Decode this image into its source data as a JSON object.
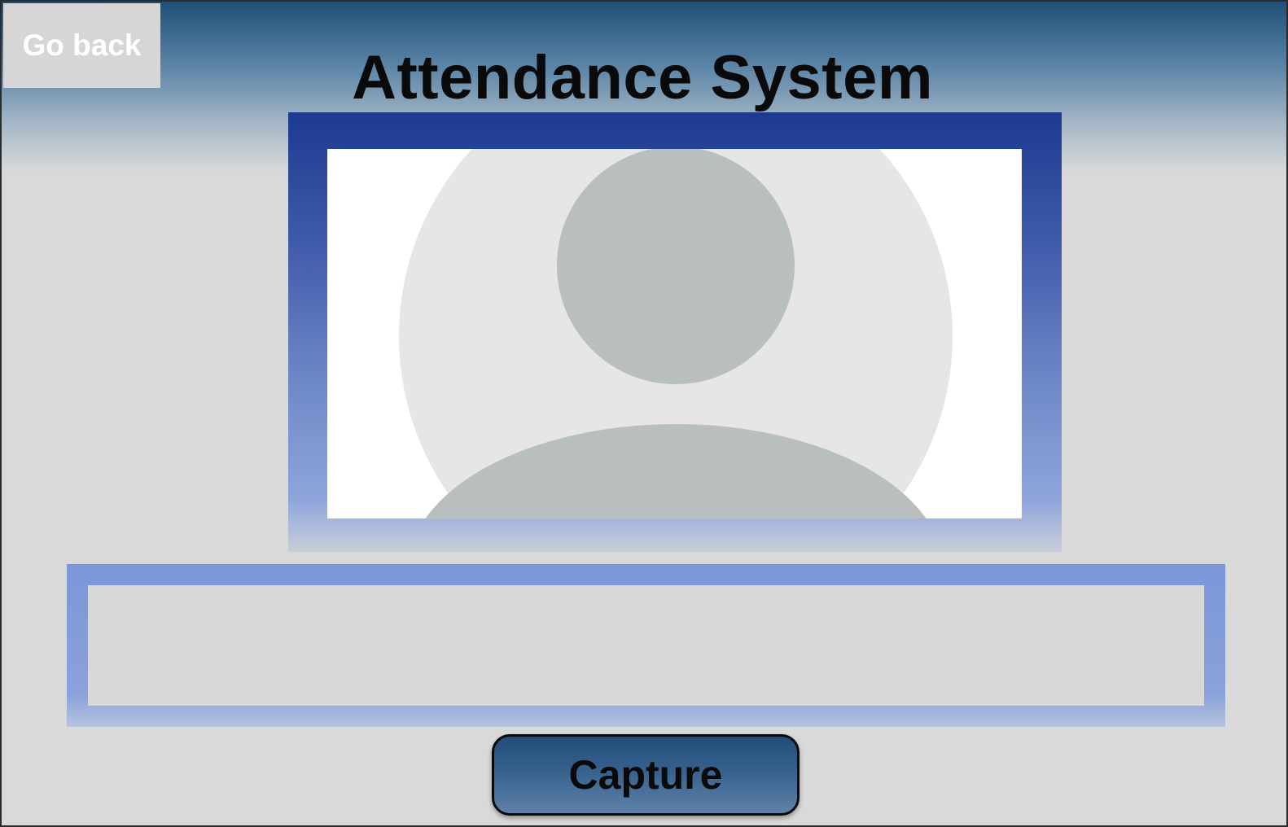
{
  "header": {
    "title": "Attendance System",
    "back_label": "Go back"
  },
  "camera": {
    "placeholder_icon": "user-avatar-icon"
  },
  "result": {
    "text": ""
  },
  "actions": {
    "capture_label": "Capture"
  },
  "colors": {
    "header_gradient_top": "#1f4f78",
    "frame_blue_dark": "#1c3a8f",
    "frame_blue_light": "#8ea5dc",
    "page_background": "#d9d9d9",
    "avatar_bg": "#e6e6e6",
    "avatar_fg": "#b9bebe"
  }
}
